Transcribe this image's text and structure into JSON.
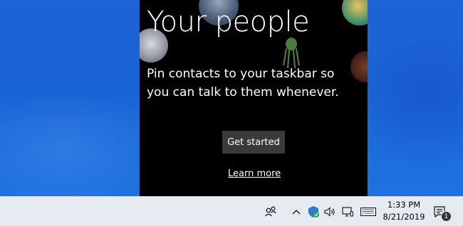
{
  "flyout": {
    "title": "Your people",
    "description": "Pin contacts to your taskbar so you can talk to them whenever.",
    "get_started_label": "Get started",
    "learn_more_label": "Learn more"
  },
  "taskbar": {
    "time": "1:33 PM",
    "date": "8/21/2019",
    "notification_count": "1",
    "icons": [
      "people-icon",
      "chevron-up-icon",
      "windows-defender-icon",
      "volume-icon",
      "network-icon",
      "touch-keyboard-icon",
      "action-center-icon"
    ]
  },
  "colors": {
    "desktop": "#1a63d4",
    "flyout_bg": "#000000",
    "button_bg": "#3a3a3a",
    "taskbar_bg": "#e6eaf1"
  }
}
